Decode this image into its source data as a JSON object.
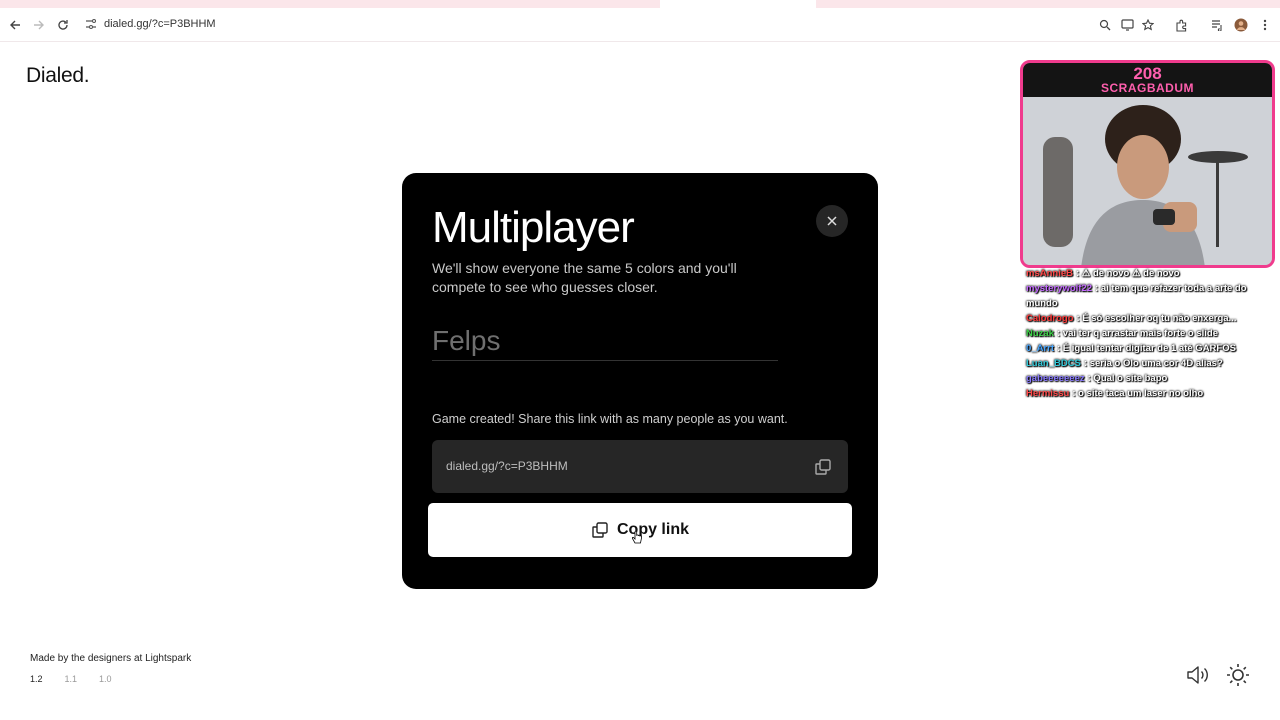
{
  "browser": {
    "url": "dialed.gg/?c=P3BHHM"
  },
  "app": {
    "brand": "Dialed."
  },
  "modal": {
    "title": "Multiplayer",
    "description": "We'll show everyone the same 5 colors and you'll compete to see who guesses closer.",
    "name_placeholder": "Felps",
    "game_created_message": "Game created! Share this link with as many people as you want.",
    "share_link": "dialed.gg/?c=P3BHHM",
    "copy_button_label": "Copy link"
  },
  "footer": {
    "credit": "Made by the designers at Lightspark",
    "versions": [
      "1.2",
      "1.1",
      "1.0"
    ]
  },
  "stream_overlay": {
    "number": "208",
    "name": "SCRAGBADUM"
  },
  "chat": [
    {
      "user": "msAnnieB",
      "color": "#ff4a4a",
      "text": ": ⚠ de novo ⚠ de novo"
    },
    {
      "user": "mysterywolf22",
      "color": "#c46bff",
      "text": ": ai tem que refazer toda a arte do mundo"
    },
    {
      "user": "Calodrogo",
      "color": "#ff3b3b",
      "text": ": É só escolher oq tu não enxerga..."
    },
    {
      "user": "Nuzak",
      "color": "#3fd24a",
      "text": ": vai ter q arrastar mais forte o slide"
    },
    {
      "user": "0_Arrt",
      "color": "#4aa8ff",
      "text": ": É igual tentar digitar de 1 até GARFOS"
    },
    {
      "user": "Luan_BDCS",
      "color": "#32c8d8",
      "text": ": seria o Olo uma cor 4D alias?"
    },
    {
      "user": "gabeeeeeeez",
      "color": "#8a7bff",
      "text": ": Qual o site bapo"
    },
    {
      "user": "Hermissu",
      "color": "#ff4a4a",
      "text": ": o site taca um laser no olho"
    }
  ]
}
